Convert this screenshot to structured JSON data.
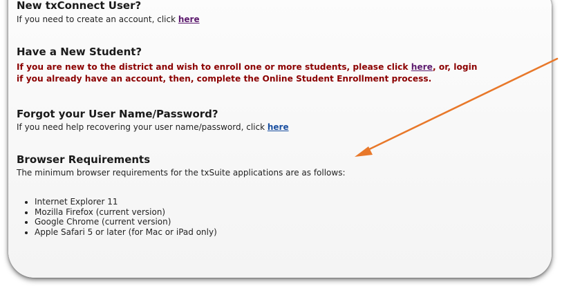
{
  "sections": [
    {
      "heading": "New txConnect User?",
      "text_before": "If you need to create an account, click ",
      "link": "here"
    },
    {
      "heading": "Have a New Student?",
      "line1_before": "If you are new to the district and wish to enroll one or more students, please click ",
      "link": "here",
      "line1_after": ", or, login",
      "line2": "if you already have an account, then, complete the Online Student Enrollment process."
    },
    {
      "heading": "Forgot your User Name/Password?",
      "text_before": "If you need help recovering your user name/password, click ",
      "link": "here"
    },
    {
      "heading": "Browser Requirements",
      "text": "The minimum browser requirements for the txSuite applications are as follows:",
      "browsers": [
        "Internet Explorer 11",
        "Mozilla Firefox (current version)",
        "Google Chrome (current version)",
        "Apple Safari 5 or later (for Mac or iPad only)"
      ]
    }
  ],
  "colors": {
    "arrow": "#e8782a",
    "alert_text": "#8b0000",
    "link_visited": "#5c1a6e",
    "link": "#1a4fa0"
  }
}
